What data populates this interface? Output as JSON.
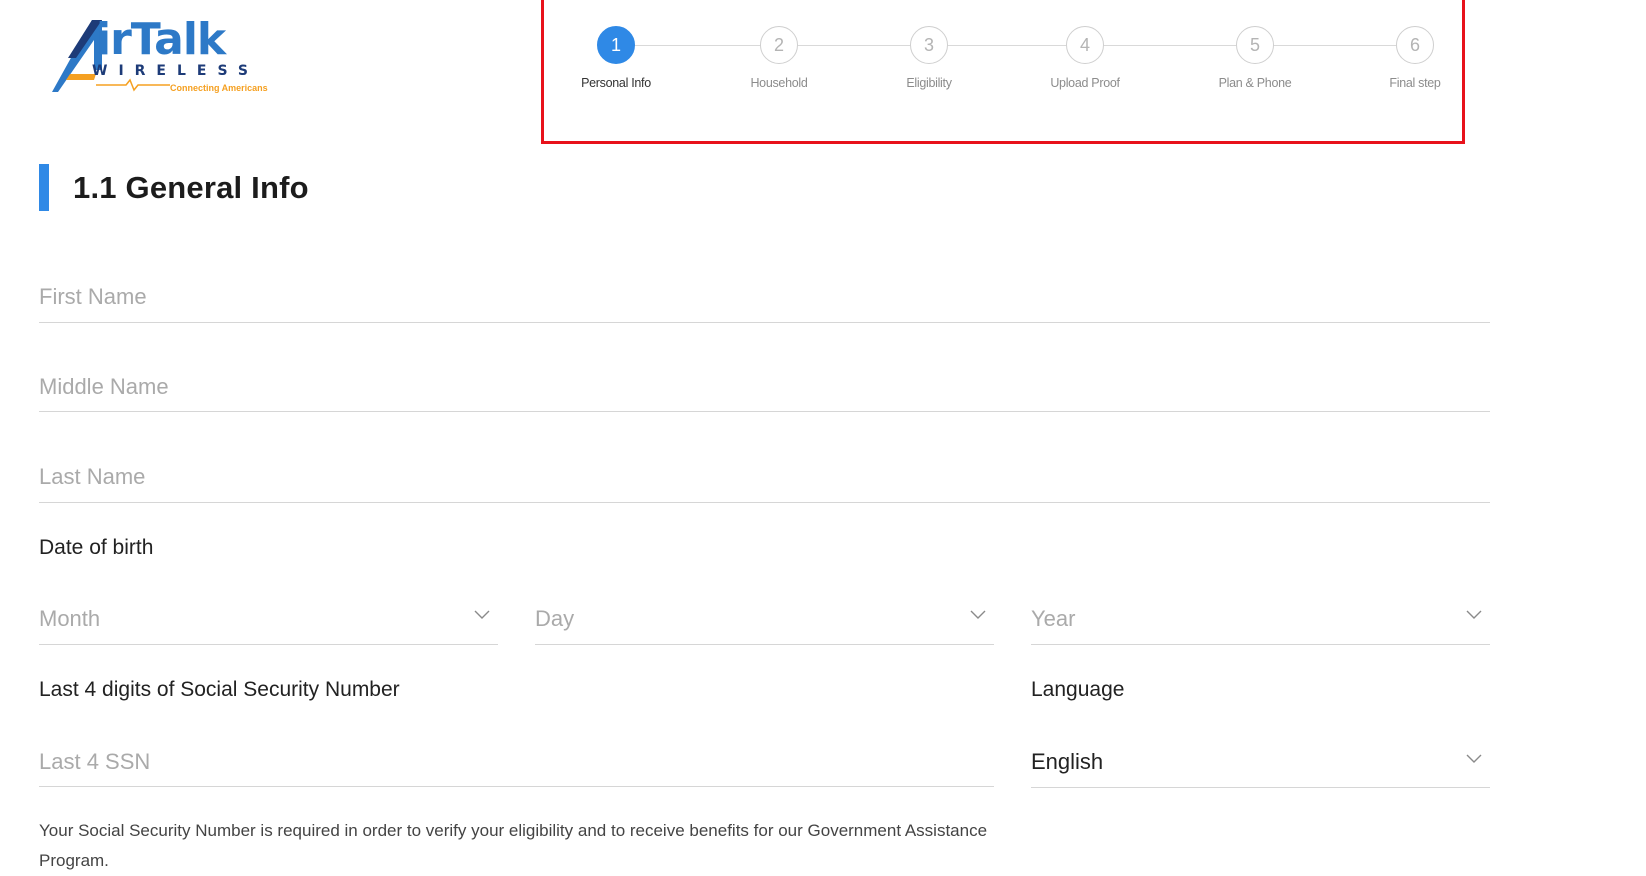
{
  "logo": {
    "brand": "irTalk",
    "subtitle": "WIRELESS",
    "tagline": "Connecting Americans",
    "colors": {
      "blue": "#2d79c7",
      "navy": "#1d3b78",
      "orange": "#f5a021"
    }
  },
  "stepper": {
    "steps": [
      {
        "number": "1",
        "label": "Personal Info",
        "active": true
      },
      {
        "number": "2",
        "label": "Household",
        "active": false
      },
      {
        "number": "3",
        "label": "Eligibility",
        "active": false
      },
      {
        "number": "4",
        "label": "Upload Proof",
        "active": false
      },
      {
        "number": "5",
        "label": "Plan & Phone",
        "active": false
      },
      {
        "number": "6",
        "label": "Final step",
        "active": false
      }
    ],
    "highlight_color": "#e8121b",
    "active_color": "#2f89e6"
  },
  "section": {
    "title": "1.1 General Info",
    "accent": "#2f89e6"
  },
  "form": {
    "first_name": {
      "placeholder": "First Name",
      "value": ""
    },
    "middle_name": {
      "placeholder": "Middle Name",
      "value": ""
    },
    "last_name": {
      "placeholder": "Last Name",
      "value": ""
    },
    "dob": {
      "label": "Date of birth",
      "month_placeholder": "Month",
      "day_placeholder": "Day",
      "year_placeholder": "Year"
    },
    "ssn": {
      "label": "Last 4 digits of Social Security Number",
      "placeholder": "Last 4 SSN",
      "value": ""
    },
    "language": {
      "label": "Language",
      "value": "English"
    },
    "ssn_note": "Your Social Security Number is required in order to verify your eligibility and to receive benefits for our Government Assistance Program."
  }
}
